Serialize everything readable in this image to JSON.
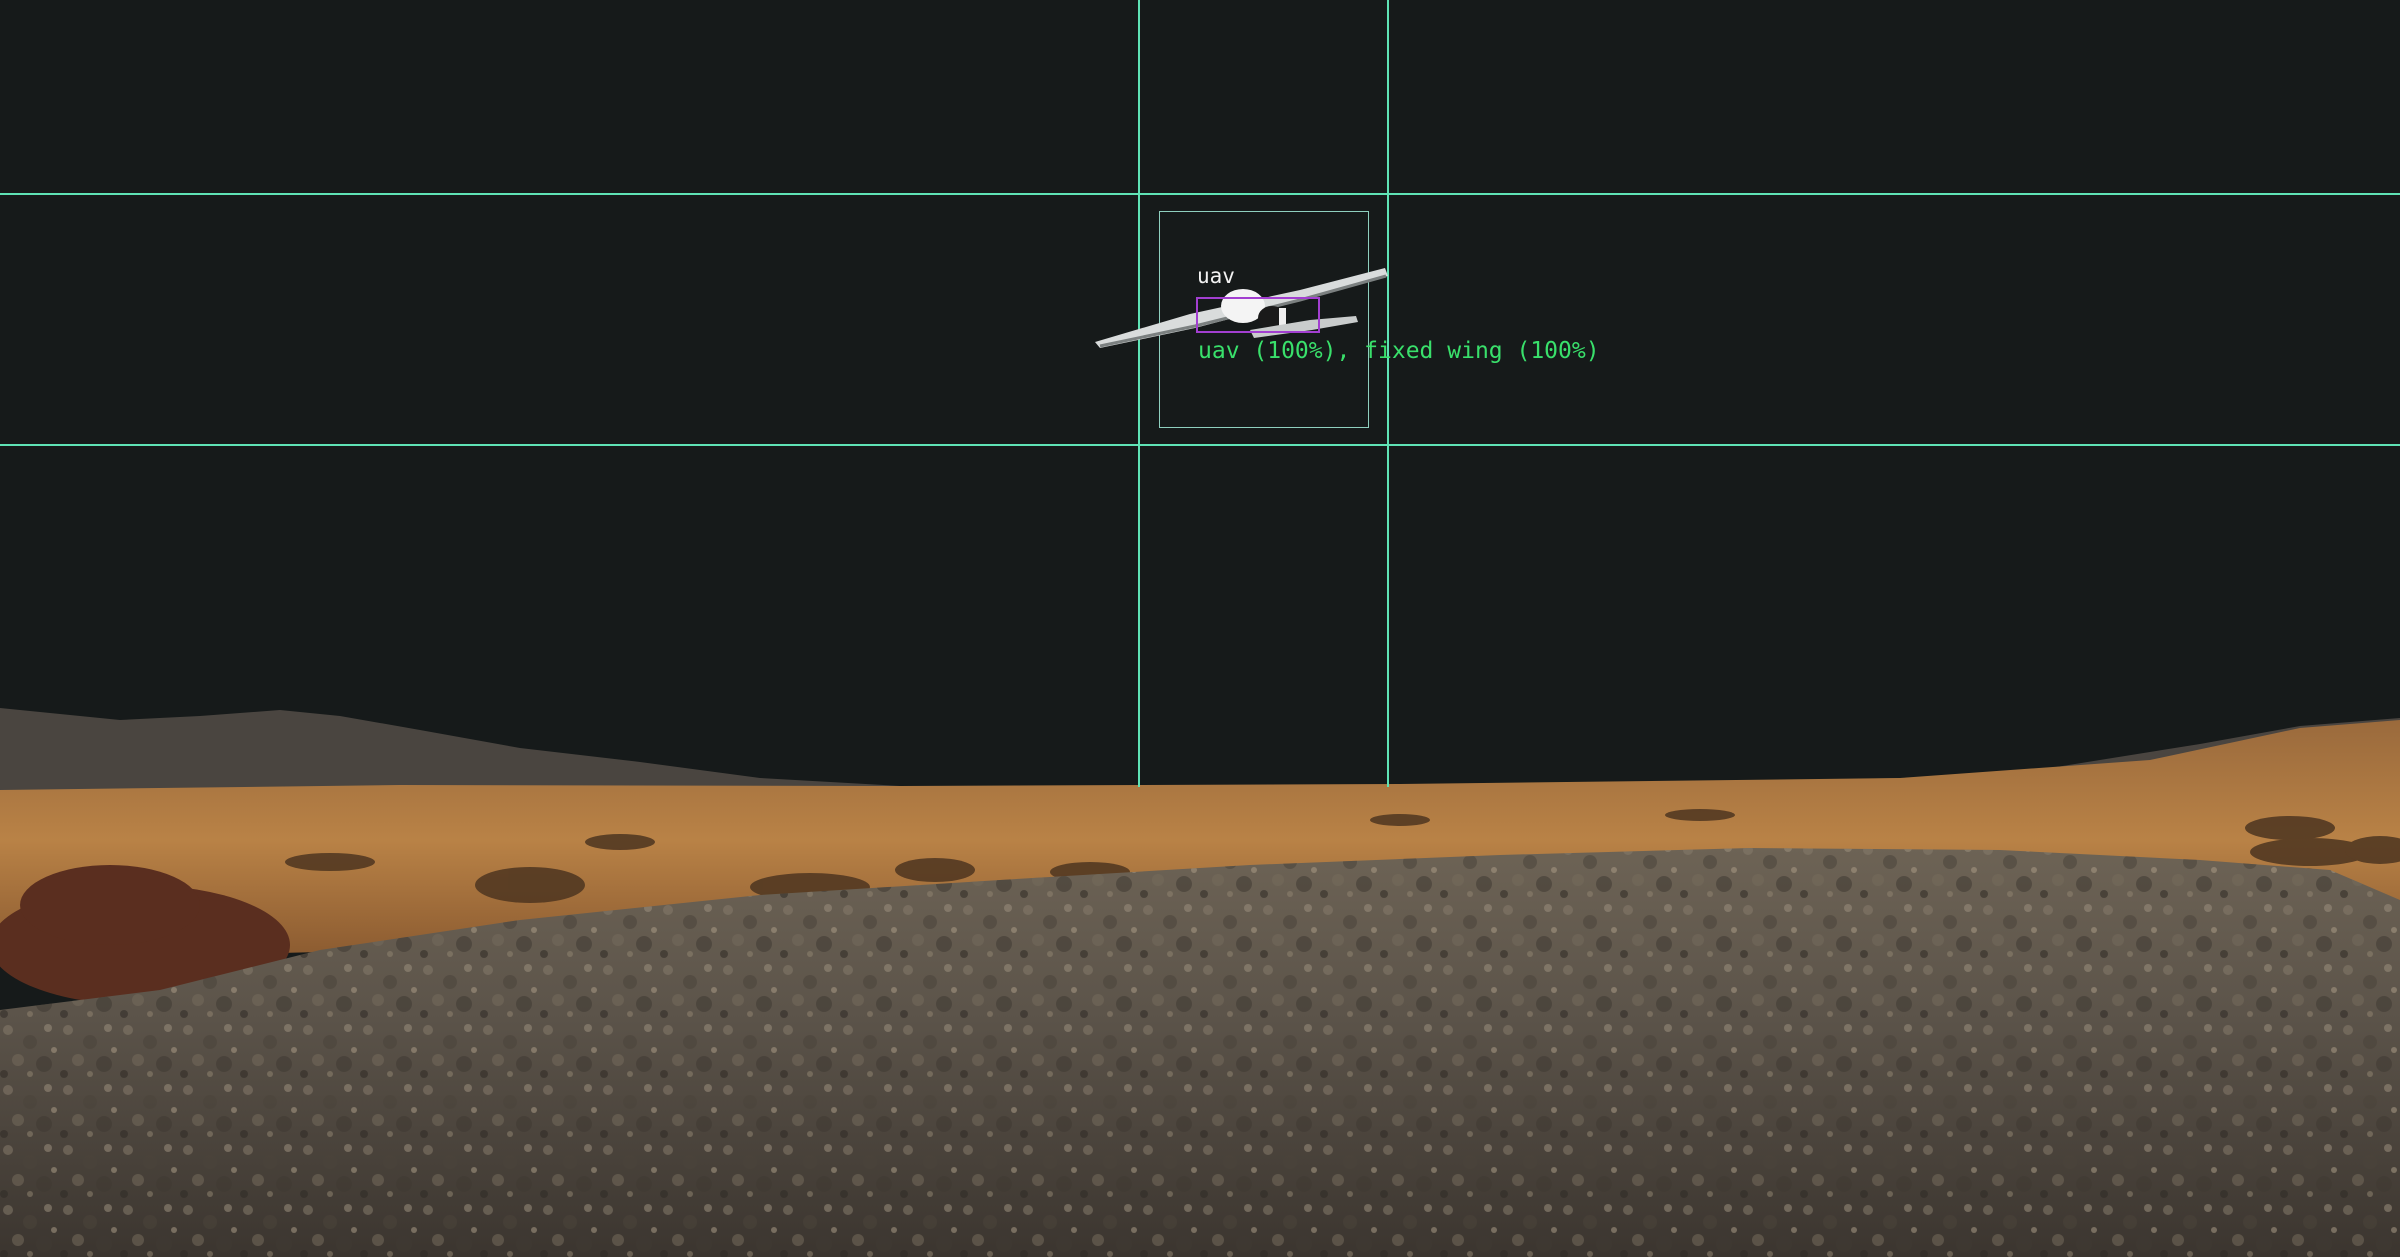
{
  "detection": {
    "class_label": "uav",
    "caption": "uav (100%), fixed wing (100%)"
  },
  "colors": {
    "sky": "#161a1a",
    "hud_lines": "#5fe3b5",
    "roi_box": "#8fd0bf",
    "detection_box": "#a23fd0",
    "caption_text": "#39e06b",
    "label_text": "#f2f2f2"
  }
}
